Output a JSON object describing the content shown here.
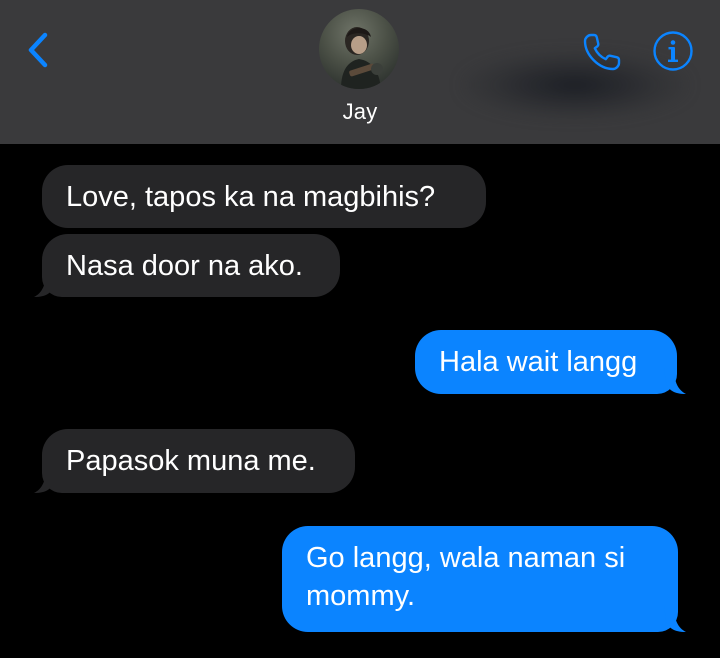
{
  "header": {
    "contact_name": "Jay",
    "back_icon": "chevron-left-icon",
    "call_icon": "phone-icon",
    "info_icon": "info-icon",
    "accent_color": "#0b84ff"
  },
  "messages": [
    {
      "direction": "incoming",
      "text": "Love, tapos ka na magbihis?"
    },
    {
      "direction": "incoming",
      "text": "Nasa door na ako."
    },
    {
      "direction": "outgoing",
      "text": "Hala wait langg"
    },
    {
      "direction": "incoming",
      "text": "Papasok muna me."
    },
    {
      "direction": "outgoing",
      "text": "Go langg, wala naman si mommy."
    }
  ],
  "colors": {
    "incoming_bubble": "#262628",
    "outgoing_bubble": "#0b84ff",
    "header_background": "#3a3a3c",
    "background": "#000000"
  }
}
